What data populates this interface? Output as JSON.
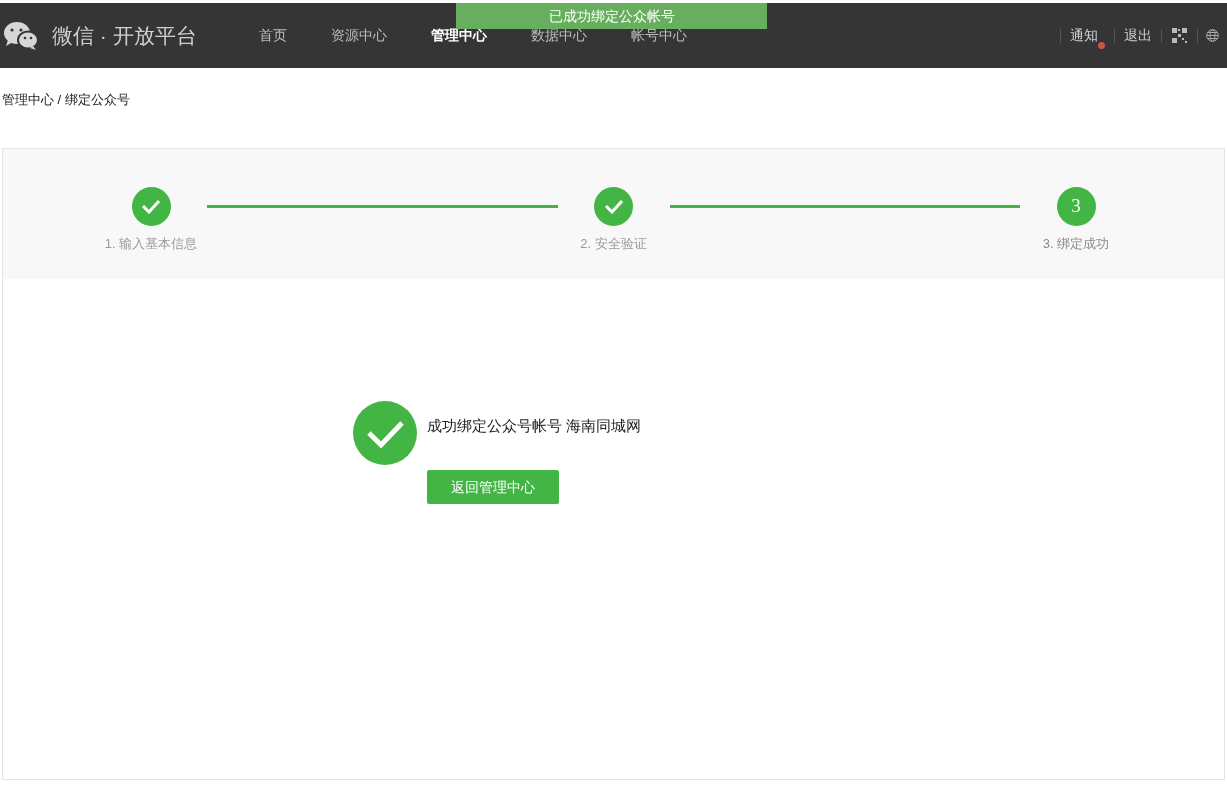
{
  "header": {
    "logo_text": "微信 · 开放平台",
    "nav": [
      {
        "label": "首页",
        "selected": false
      },
      {
        "label": "资源中心",
        "selected": false
      },
      {
        "label": "管理中心",
        "selected": true
      },
      {
        "label": "数据中心",
        "selected": false
      },
      {
        "label": "帐号中心",
        "selected": false
      }
    ],
    "notice": {
      "label": "通知",
      "unread": true
    },
    "logout": "退出"
  },
  "toast": "已成功绑定公众帐号",
  "breadcrumb": "管理中心 / 绑定公众号",
  "steps": [
    {
      "label": "1. 输入基本信息",
      "done": true
    },
    {
      "label": "2. 安全验证",
      "done": true
    },
    {
      "label": "3. 绑定成功",
      "done": false,
      "number": "3"
    }
  ],
  "result": {
    "message": "成功绑定公众号帐号 海南同城网",
    "button": "返回管理中心"
  }
}
